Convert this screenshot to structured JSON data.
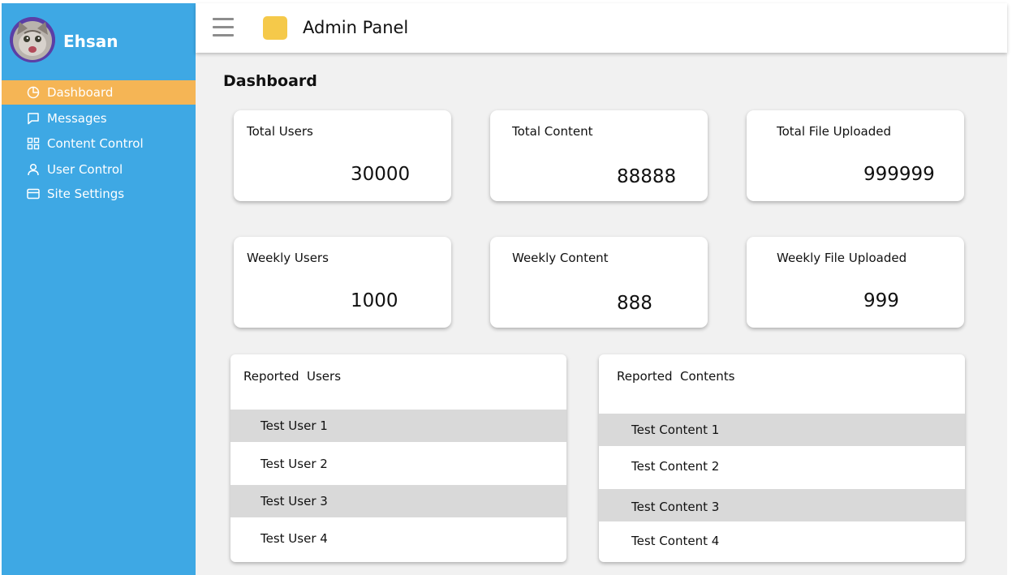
{
  "user": {
    "name": "Ehsan"
  },
  "sidebar": {
    "items": [
      {
        "label": "Dashboard",
        "icon": "pie-chart-icon"
      },
      {
        "label": "Messages",
        "icon": "message-icon"
      },
      {
        "label": "Content Control",
        "icon": "grid-icon"
      },
      {
        "label": "User Control",
        "icon": "user-icon"
      },
      {
        "label": "Site Settings",
        "icon": "card-icon"
      }
    ]
  },
  "header": {
    "title": "Admin Panel"
  },
  "main": {
    "title": "Dashboard",
    "stats": [
      {
        "label": "Total Users",
        "value": "30000"
      },
      {
        "label": "Total Content",
        "value": "88888"
      },
      {
        "label": "Total File Uploaded",
        "value": "999999"
      },
      {
        "label": "Weekly Users",
        "value": "1000"
      },
      {
        "label": "Weekly Content",
        "value": "888"
      },
      {
        "label": "Weekly File Uploaded",
        "value": "999"
      }
    ],
    "reported_users": {
      "title": "Reported  Users",
      "items": [
        "Test User 1",
        "Test User 2",
        "Test User 3",
        "Test User 4"
      ]
    },
    "reported_contents": {
      "title": "Reported  Contents",
      "items": [
        "Test Content 1",
        "Test Content 2",
        "Test Content 3",
        "Test Content 4"
      ]
    }
  },
  "colors": {
    "sidebar": "#3ea8e4",
    "active_item": "#f5b555",
    "brand": "#f5c94a",
    "background": "#f1f1f1",
    "row_shade": "#d9d9d9"
  }
}
